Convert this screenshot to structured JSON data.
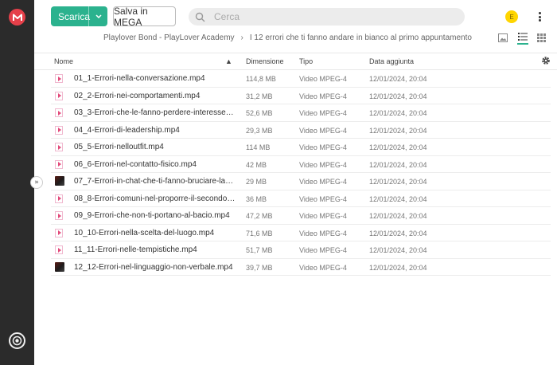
{
  "header": {
    "download_label": "Scarica",
    "save_label": "Salva in MEGA",
    "search_placeholder": "Cerca",
    "avatar_initial": "E"
  },
  "breadcrumb": {
    "parent": "Playlover Bond - PlayLover Academy",
    "separator": "›",
    "current": "I 12 errori che ti fanno andare in bianco al primo appuntamento"
  },
  "table": {
    "columns": {
      "name": "Nome",
      "size": "Dimensione",
      "type": "Tipo",
      "date": "Data aggiunta"
    },
    "rows": [
      {
        "name": "01_1-Errori-nella-conversazione.mp4",
        "size": "114,8 MB",
        "type": "Video MPEG-4",
        "date": "12/01/2024, 20:04",
        "icon": "video-file-icon"
      },
      {
        "name": "02_2-Errori-nei-comportamenti.mp4",
        "size": "31,2 MB",
        "type": "Video MPEG-4",
        "date": "12/01/2024, 20:04",
        "icon": "video-file-icon"
      },
      {
        "name": "03_3-Errori-che-le-fanno-perdere-interesse.mp4",
        "size": "52,6 MB",
        "type": "Video MPEG-4",
        "date": "12/01/2024, 20:04",
        "icon": "video-file-icon"
      },
      {
        "name": "04_4-Errori-di-leadership.mp4",
        "size": "29,3 MB",
        "type": "Video MPEG-4",
        "date": "12/01/2024, 20:04",
        "icon": "video-file-icon"
      },
      {
        "name": "05_5-Errori-nelloutfit.mp4",
        "size": "114 MB",
        "type": "Video MPEG-4",
        "date": "12/01/2024, 20:04",
        "icon": "video-file-icon"
      },
      {
        "name": "06_6-Errori-nel-contatto-fisico.mp4",
        "size": "42 MB",
        "type": "Video MPEG-4",
        "date": "12/01/2024, 20:04",
        "icon": "video-file-icon"
      },
      {
        "name": "07_7-Errori-in-chat-che-ti-fanno-bruciare-lapp...",
        "size": "29 MB",
        "type": "Video MPEG-4",
        "date": "12/01/2024, 20:04",
        "icon": "video-thumbnail"
      },
      {
        "name": "08_8-Errori-comuni-nel-proporre-il-secondo-a...",
        "size": "36 MB",
        "type": "Video MPEG-4",
        "date": "12/01/2024, 20:04",
        "icon": "video-file-icon"
      },
      {
        "name": "09_9-Errori-che-non-ti-portano-al-bacio.mp4",
        "size": "47,2 MB",
        "type": "Video MPEG-4",
        "date": "12/01/2024, 20:04",
        "icon": "video-file-icon"
      },
      {
        "name": "10_10-Errori-nella-scelta-del-luogo.mp4",
        "size": "71,6 MB",
        "type": "Video MPEG-4",
        "date": "12/01/2024, 20:04",
        "icon": "video-file-icon"
      },
      {
        "name": "11_11-Errori-nelle-tempistiche.mp4",
        "size": "51,7 MB",
        "type": "Video MPEG-4",
        "date": "12/01/2024, 20:04",
        "icon": "video-file-icon"
      },
      {
        "name": "12_12-Errori-nel-linguaggio-non-verbale.mp4",
        "size": "39,7 MB",
        "type": "Video MPEG-4",
        "date": "12/01/2024, 20:04",
        "icon": "video-thumbnail"
      }
    ]
  },
  "colors": {
    "accent": "#2bb28e",
    "brand": "#e5404a",
    "sidebar": "#2b2b2b",
    "avatar": "#ffd500"
  }
}
